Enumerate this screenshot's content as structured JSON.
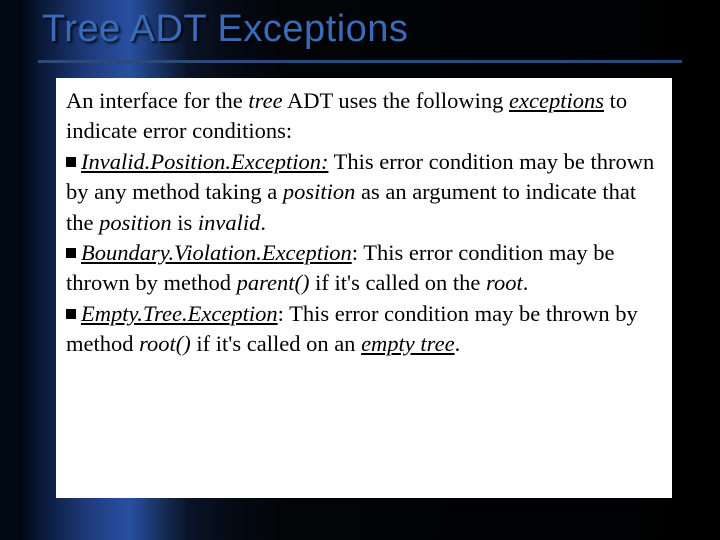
{
  "slide": {
    "title": "Tree ADT Exceptions",
    "intro_1": "An interface for the ",
    "intro_tree": "tree",
    "intro_2": " ADT uses the following ",
    "intro_exceptions": "exceptions",
    "intro_3": " to indicate error conditions:",
    "b1_name": "Invalid.Position.Exception:",
    "b1_a": " This error condition may be thrown by any method taking a ",
    "b1_pos1": "position",
    "b1_b": " as an argument to indicate that the ",
    "b1_pos2": "position",
    "b1_c": " is ",
    "b1_invalid": "invalid",
    "b1_d": ".",
    "b2_name": "Boundary.Violation.Exception",
    "b2_a": ": This error condition may be thrown by method ",
    "b2_parent": "parent()",
    "b2_b": " if it's called on the ",
    "b2_root": "root",
    "b2_c": ".",
    "b3_name": "Empty.Tree.Exception",
    "b3_a": ": This error condition may be thrown by method ",
    "b3_root": "root()",
    "b3_b": " if it's called on an ",
    "b3_empty": "empty tree",
    "b3_c": "."
  }
}
